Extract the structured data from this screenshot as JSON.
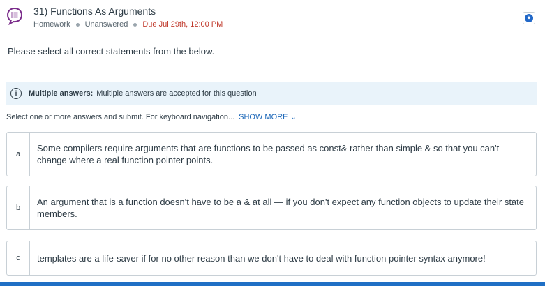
{
  "question": {
    "title": "31) Functions As Arguments",
    "type": "Homework",
    "status": "Unanswered",
    "due": "Due Jul 29th, 12:00 PM",
    "prompt": "Please select all correct statements from the below."
  },
  "info_banner": {
    "label": "Multiple answers:",
    "text": "Multiple answers are accepted for this question"
  },
  "instructions": {
    "text": "Select one or more answers and submit. For keyboard navigation...",
    "show_more": "SHOW MORE"
  },
  "options": [
    {
      "letter": "a",
      "text": "Some compilers require arguments that are functions to be passed as const& rather than simple & so that you can't change where a real function pointer points."
    },
    {
      "letter": "b",
      "text": "An argument that is a function doesn't have to be a & at all — if you don't expect any function objects to update their state members."
    },
    {
      "letter": "c",
      "text": "templates are a life-saver if for no other reason than we don't have to deal with function pointer syntax anymore!"
    }
  ],
  "icons": {
    "question": "chat-bubble-list-icon",
    "star": "star-icon",
    "info": "info-icon",
    "chevron": "chevron-down-icon"
  },
  "colors": {
    "icon_purple": "#7b2d8b",
    "due_red": "#c0392b",
    "link_blue": "#1a66b8",
    "banner_bg": "#e9f3fa",
    "bottom_bar": "#1f6fc5"
  }
}
